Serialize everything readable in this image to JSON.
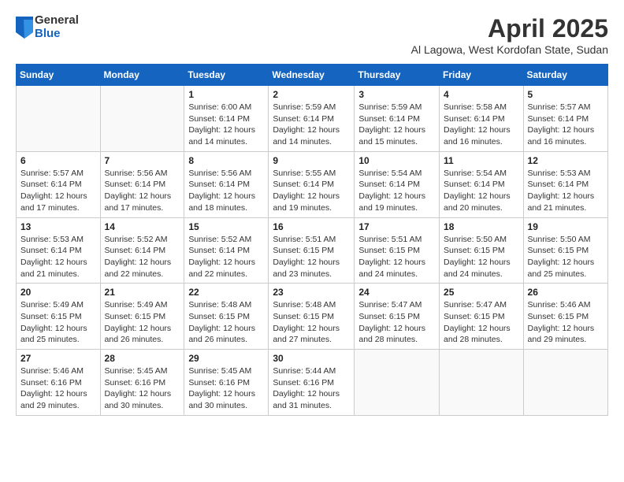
{
  "logo": {
    "general": "General",
    "blue": "Blue"
  },
  "title": "April 2025",
  "subtitle": "Al Lagowa, West Kordofan State, Sudan",
  "weekdays": [
    "Sunday",
    "Monday",
    "Tuesday",
    "Wednesday",
    "Thursday",
    "Friday",
    "Saturday"
  ],
  "weeks": [
    [
      {
        "day": "",
        "info": ""
      },
      {
        "day": "",
        "info": ""
      },
      {
        "day": "1",
        "info": "Sunrise: 6:00 AM\nSunset: 6:14 PM\nDaylight: 12 hours and 14 minutes."
      },
      {
        "day": "2",
        "info": "Sunrise: 5:59 AM\nSunset: 6:14 PM\nDaylight: 12 hours and 14 minutes."
      },
      {
        "day": "3",
        "info": "Sunrise: 5:59 AM\nSunset: 6:14 PM\nDaylight: 12 hours and 15 minutes."
      },
      {
        "day": "4",
        "info": "Sunrise: 5:58 AM\nSunset: 6:14 PM\nDaylight: 12 hours and 16 minutes."
      },
      {
        "day": "5",
        "info": "Sunrise: 5:57 AM\nSunset: 6:14 PM\nDaylight: 12 hours and 16 minutes."
      }
    ],
    [
      {
        "day": "6",
        "info": "Sunrise: 5:57 AM\nSunset: 6:14 PM\nDaylight: 12 hours and 17 minutes."
      },
      {
        "day": "7",
        "info": "Sunrise: 5:56 AM\nSunset: 6:14 PM\nDaylight: 12 hours and 17 minutes."
      },
      {
        "day": "8",
        "info": "Sunrise: 5:56 AM\nSunset: 6:14 PM\nDaylight: 12 hours and 18 minutes."
      },
      {
        "day": "9",
        "info": "Sunrise: 5:55 AM\nSunset: 6:14 PM\nDaylight: 12 hours and 19 minutes."
      },
      {
        "day": "10",
        "info": "Sunrise: 5:54 AM\nSunset: 6:14 PM\nDaylight: 12 hours and 19 minutes."
      },
      {
        "day": "11",
        "info": "Sunrise: 5:54 AM\nSunset: 6:14 PM\nDaylight: 12 hours and 20 minutes."
      },
      {
        "day": "12",
        "info": "Sunrise: 5:53 AM\nSunset: 6:14 PM\nDaylight: 12 hours and 21 minutes."
      }
    ],
    [
      {
        "day": "13",
        "info": "Sunrise: 5:53 AM\nSunset: 6:14 PM\nDaylight: 12 hours and 21 minutes."
      },
      {
        "day": "14",
        "info": "Sunrise: 5:52 AM\nSunset: 6:14 PM\nDaylight: 12 hours and 22 minutes."
      },
      {
        "day": "15",
        "info": "Sunrise: 5:52 AM\nSunset: 6:14 PM\nDaylight: 12 hours and 22 minutes."
      },
      {
        "day": "16",
        "info": "Sunrise: 5:51 AM\nSunset: 6:15 PM\nDaylight: 12 hours and 23 minutes."
      },
      {
        "day": "17",
        "info": "Sunrise: 5:51 AM\nSunset: 6:15 PM\nDaylight: 12 hours and 24 minutes."
      },
      {
        "day": "18",
        "info": "Sunrise: 5:50 AM\nSunset: 6:15 PM\nDaylight: 12 hours and 24 minutes."
      },
      {
        "day": "19",
        "info": "Sunrise: 5:50 AM\nSunset: 6:15 PM\nDaylight: 12 hours and 25 minutes."
      }
    ],
    [
      {
        "day": "20",
        "info": "Sunrise: 5:49 AM\nSunset: 6:15 PM\nDaylight: 12 hours and 25 minutes."
      },
      {
        "day": "21",
        "info": "Sunrise: 5:49 AM\nSunset: 6:15 PM\nDaylight: 12 hours and 26 minutes."
      },
      {
        "day": "22",
        "info": "Sunrise: 5:48 AM\nSunset: 6:15 PM\nDaylight: 12 hours and 26 minutes."
      },
      {
        "day": "23",
        "info": "Sunrise: 5:48 AM\nSunset: 6:15 PM\nDaylight: 12 hours and 27 minutes."
      },
      {
        "day": "24",
        "info": "Sunrise: 5:47 AM\nSunset: 6:15 PM\nDaylight: 12 hours and 28 minutes."
      },
      {
        "day": "25",
        "info": "Sunrise: 5:47 AM\nSunset: 6:15 PM\nDaylight: 12 hours and 28 minutes."
      },
      {
        "day": "26",
        "info": "Sunrise: 5:46 AM\nSunset: 6:15 PM\nDaylight: 12 hours and 29 minutes."
      }
    ],
    [
      {
        "day": "27",
        "info": "Sunrise: 5:46 AM\nSunset: 6:16 PM\nDaylight: 12 hours and 29 minutes."
      },
      {
        "day": "28",
        "info": "Sunrise: 5:45 AM\nSunset: 6:16 PM\nDaylight: 12 hours and 30 minutes."
      },
      {
        "day": "29",
        "info": "Sunrise: 5:45 AM\nSunset: 6:16 PM\nDaylight: 12 hours and 30 minutes."
      },
      {
        "day": "30",
        "info": "Sunrise: 5:44 AM\nSunset: 6:16 PM\nDaylight: 12 hours and 31 minutes."
      },
      {
        "day": "",
        "info": ""
      },
      {
        "day": "",
        "info": ""
      },
      {
        "day": "",
        "info": ""
      }
    ]
  ]
}
